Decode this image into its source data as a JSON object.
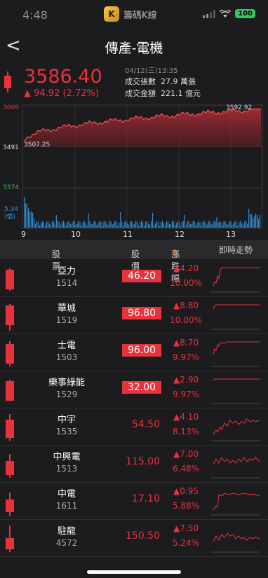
{
  "status_bar": {
    "time": "4:48",
    "app_name": "籌碼K線",
    "app_logo_letter": "K",
    "battery": "100"
  },
  "nav": {
    "back_label": "<",
    "title": "傳產-電機"
  },
  "quote": {
    "price": "3586.40",
    "change": "▲ 94.92 (2.72%)",
    "datetime": "04/12(三)13:35",
    "volume_label": "成交張數",
    "volume_value": "27.9 萬張",
    "amount_label": "成交金額",
    "amount_value": "221.1 億元"
  },
  "intraday_chart": {
    "type": "area",
    "y_ticks": [
      "3609",
      "3491",
      "3374"
    ],
    "high_label": "3592.92",
    "low_label": "3507.25",
    "volume_label_1": "5.34",
    "volume_label_2": "(億)",
    "x_labels": [
      "9",
      "10",
      "11",
      "12",
      "13"
    ],
    "colors": {
      "line": "#e8323c",
      "volume": "#2f8fd8"
    }
  },
  "table": {
    "headers": {
      "stock": "股票",
      "price": "股價",
      "change": "漲跌幅",
      "trend": "即時走勢"
    },
    "rows": [
      {
        "name": "亞力",
        "code": "1514",
        "price": "46.20",
        "boxed": true,
        "change": "▲4.20",
        "pct": "10.00%"
      },
      {
        "name": "華城",
        "code": "1519",
        "price": "96.80",
        "boxed": true,
        "change": "▲8.80",
        "pct": "10.00%"
      },
      {
        "name": "士電",
        "code": "1503",
        "price": "96.00",
        "boxed": true,
        "change": "▲8.70",
        "pct": "9.97%"
      },
      {
        "name": "樂事綠能",
        "code": "1529",
        "price": "32.00",
        "boxed": true,
        "change": "▲2.90",
        "pct": "9.97%"
      },
      {
        "name": "中宇",
        "code": "1535",
        "price": "54.50",
        "boxed": false,
        "change": "▲4.10",
        "pct": "8.13%"
      },
      {
        "name": "中興電",
        "code": "1513",
        "price": "115.00",
        "boxed": false,
        "change": "▲7.00",
        "pct": "6.48%"
      },
      {
        "name": "中電",
        "code": "1611",
        "price": "17.10",
        "boxed": false,
        "change": "▲0.95",
        "pct": "5.88%"
      },
      {
        "name": "駐龍",
        "code": "4572",
        "price": "150.50",
        "boxed": false,
        "change": "▲7.50",
        "pct": "5.24%"
      }
    ]
  }
}
